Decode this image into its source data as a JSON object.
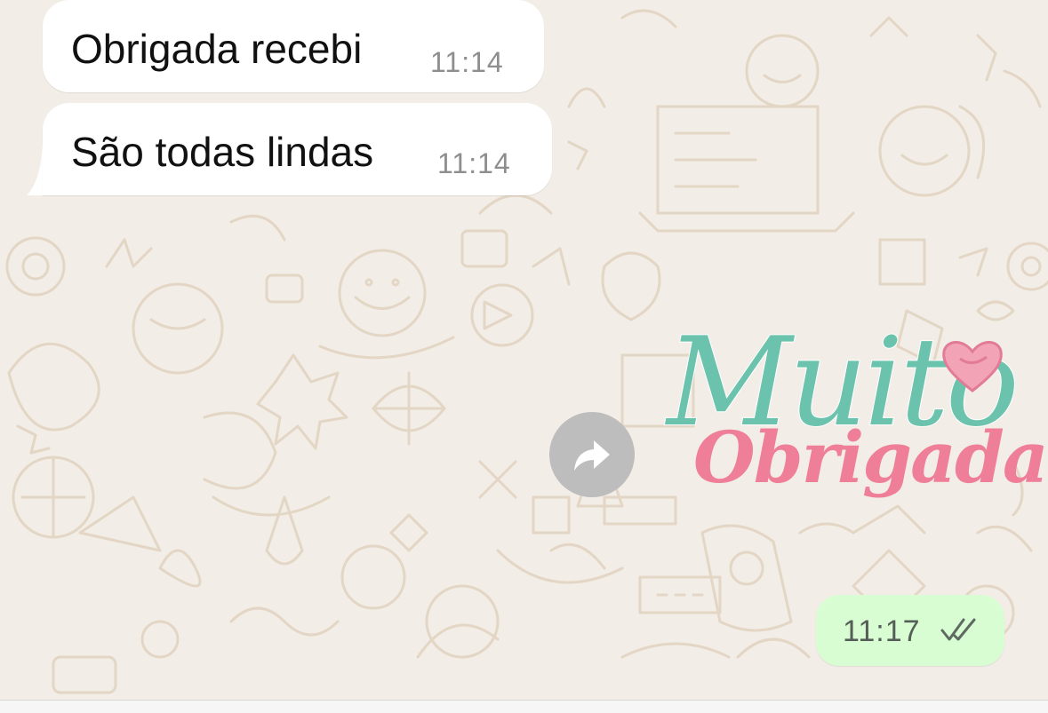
{
  "chat": {
    "messages_in": [
      {
        "text": "Obrigada recebi",
        "time": "11:14"
      },
      {
        "text": "São todas lindas",
        "time": "11:14"
      }
    ],
    "sticker": {
      "line1": "Muito",
      "line2": "Obrigada!"
    },
    "message_out": {
      "time": "11:17",
      "status_icon": "double-check-read-icon"
    },
    "forward_icon": "forward-arrow-icon"
  },
  "colors": {
    "wallpaper": "#f2ede6",
    "incoming_bubble": "#ffffff",
    "outgoing_bubble": "#d8fdd2",
    "sticker_teal": "#6cc3ad",
    "sticker_pink": "#ef7f98",
    "forward_button": "#bdbdbd"
  }
}
